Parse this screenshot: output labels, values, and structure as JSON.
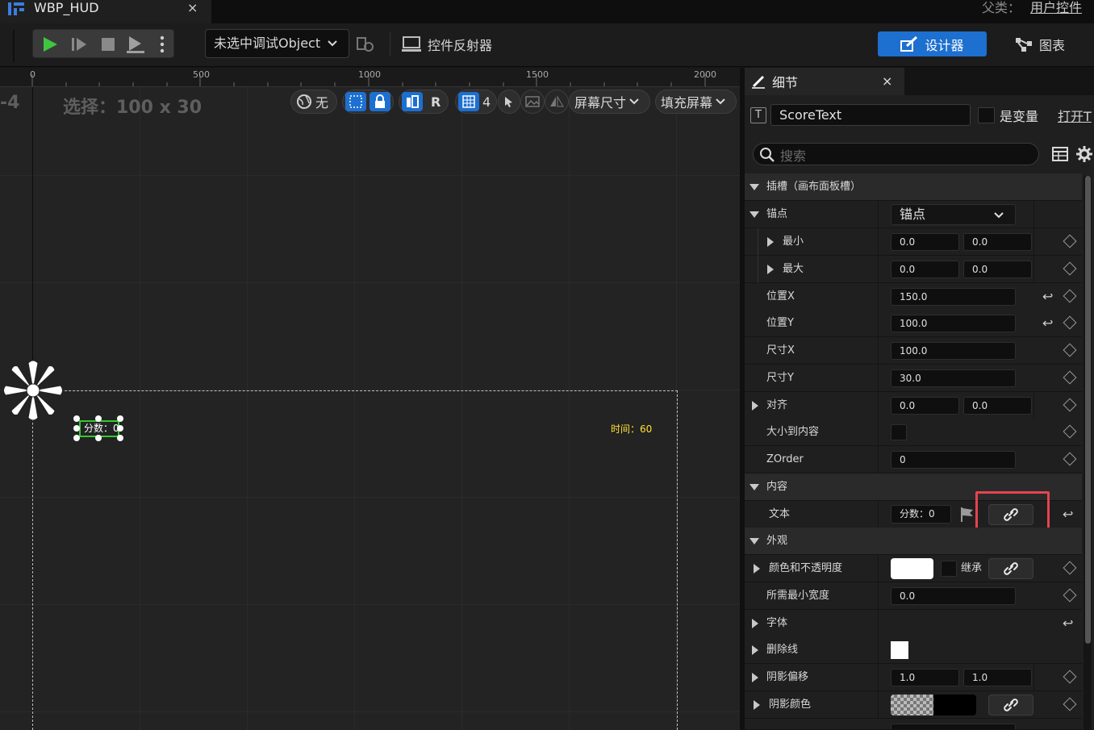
{
  "tab": {
    "title": "WBP_HUD",
    "close": "×"
  },
  "parent": {
    "label": "父类：",
    "link": "用户控件"
  },
  "toolbar": {
    "debug_select": "未选中调试Object",
    "reflector_label": "控件反射器",
    "designer_label": "设计器",
    "graph_label": "图表"
  },
  "canvas": {
    "ruler_labels": [
      "0",
      "500",
      "1000",
      "1500",
      "2000"
    ],
    "zoom_text": "-4",
    "selection_text": "选择：100 x 30",
    "pill_none": "无",
    "pill_r": "R",
    "pill_grid": "4",
    "screen_size": "屏幕尺寸",
    "fill_screen": "填充屏幕",
    "score_text": "分数：0",
    "time_text": "时间：60"
  },
  "details": {
    "tab_label": "细节",
    "close": "×",
    "name_value": "ScoreText",
    "is_variable": "是变量",
    "open_link": "打开T",
    "search_placeholder": "搜索",
    "rows": {
      "slot": "插槽（画布面板槽）",
      "anchors": "锚点",
      "anchors_value": "锚点",
      "min": "最小",
      "min_x": "0.0",
      "min_y": "0.0",
      "max": "最大",
      "max_x": "0.0",
      "max_y": "0.0",
      "pos_x": "位置X",
      "pos_x_value": "150.0",
      "pos_y": "位置Y",
      "pos_y_value": "100.0",
      "size_x": "尺寸X",
      "size_x_value": "100.0",
      "size_y": "尺寸Y",
      "size_y_value": "30.0",
      "align": "对齐",
      "align_x": "0.0",
      "align_y": "0.0",
      "size_to_content": "大小到内容",
      "zorder": "ZOrder",
      "zorder_value": "0",
      "content": "内容",
      "text": "文本",
      "text_value": "分数：0",
      "appearance": "外观",
      "color_opacity": "颜色和不透明度",
      "inherit": "继承",
      "min_width": "所需最小宽度",
      "min_width_value": "0.0",
      "font": "字体",
      "strikethrough": "删除线",
      "shadow_offset": "阴影偏移",
      "shadow_offset_x": "1.0",
      "shadow_offset_y": "1.0",
      "shadow_color": "阴影颜色"
    }
  },
  "colors": {
    "accent": "#1d6fd0",
    "highlight": "#e5434f",
    "selection_green": "#2ecc2e",
    "time_yellow": "#ffe033"
  }
}
